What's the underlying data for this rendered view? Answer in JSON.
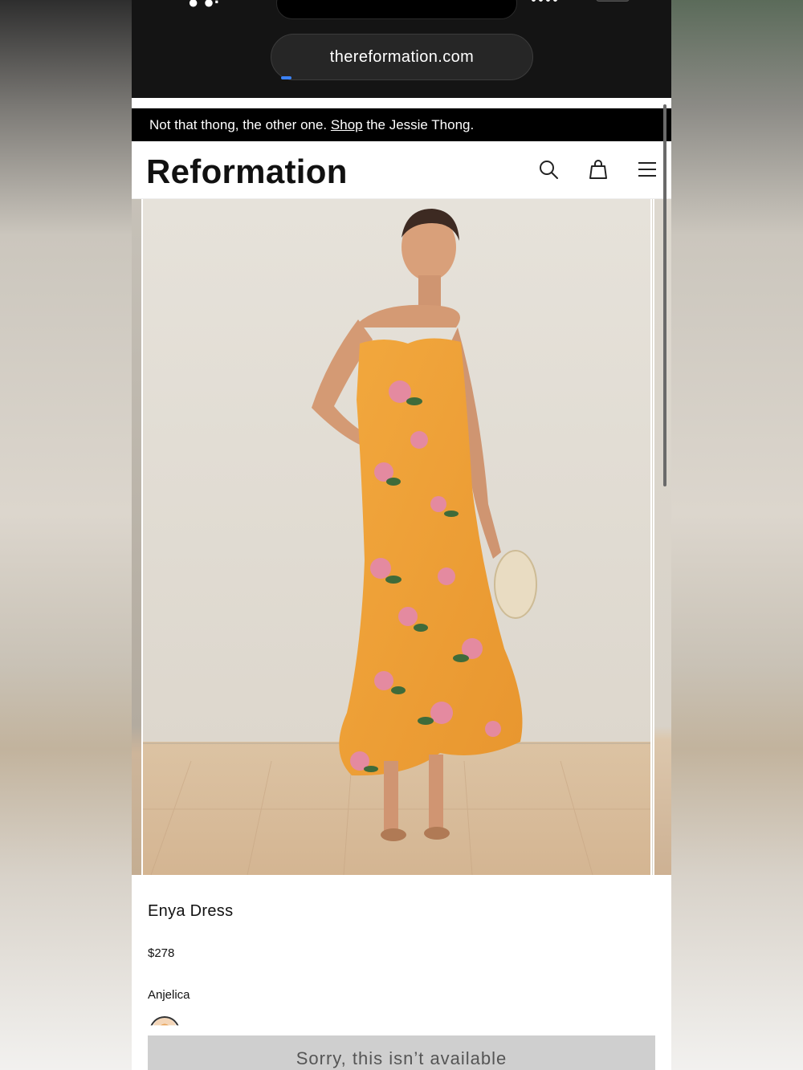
{
  "browser": {
    "url": "thereformation.com",
    "load_progress": 0.04
  },
  "promo": {
    "text_before": "Not that thong, the other one.",
    "link_text": "Shop",
    "text_after": "the Jessie Thong."
  },
  "header": {
    "logo": "Reformation",
    "icons": [
      "search-icon",
      "shopping-bag-icon",
      "menu-icon"
    ]
  },
  "product": {
    "name": "Enya Dress",
    "price": "$278",
    "color": "Anjelica",
    "availability_button": "Sorry, this isn’t available"
  },
  "colors": {
    "dress": "#F0A33A",
    "wall": "#E4E0D8",
    "floor": "#D9BC98",
    "button": "#CFCFCF"
  }
}
